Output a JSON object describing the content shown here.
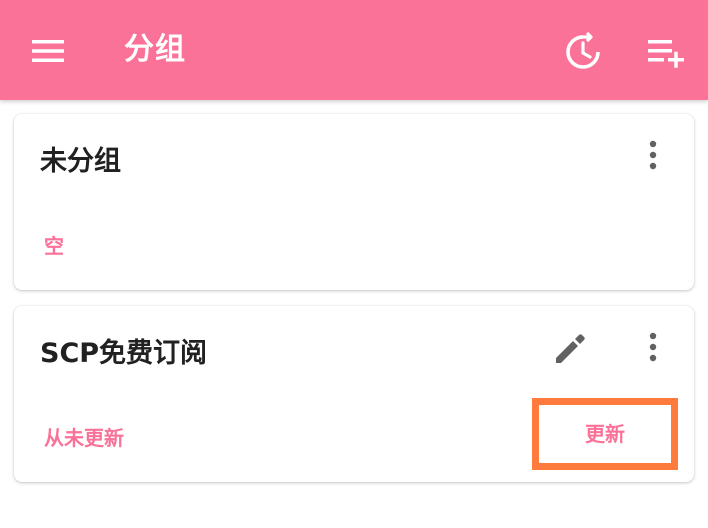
{
  "appbar": {
    "title": "分组",
    "menu_icon": "menu-icon",
    "history_icon": "history-icon",
    "add_icon": "playlist-add-icon",
    "color": "#fb7299"
  },
  "groups": [
    {
      "name": "未分组",
      "status": "空",
      "more_icon": "more-vert-icon"
    },
    {
      "name": "SCP免费订阅",
      "status": "从未更新",
      "edit_icon": "edit-icon",
      "more_icon": "more-vert-icon",
      "update_label": "更新"
    }
  ],
  "colors": {
    "accent": "#fb7299",
    "highlight_border": "#ff7a3d",
    "text": "#212121",
    "icon": "#616161"
  }
}
